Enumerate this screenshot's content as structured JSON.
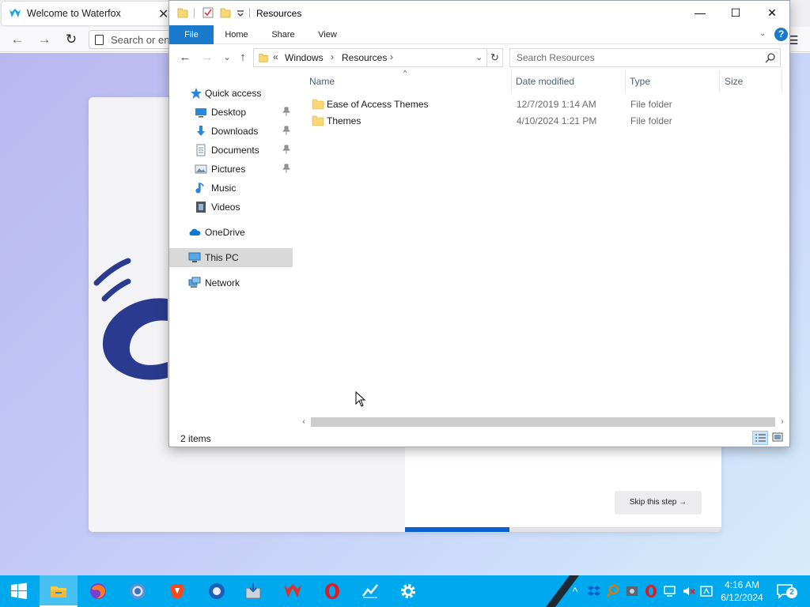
{
  "browser": {
    "tab_title": "Welcome to Waterfox",
    "close_glyph": "✕",
    "url_placeholder": "Search or enter address",
    "back_glyph": "←",
    "forward_glyph": "→",
    "reload_glyph": "↻",
    "menu_glyph": "☰",
    "skip_label": "Skip this step →",
    "progress_fraction": 0.33
  },
  "explorer": {
    "title": "Resources",
    "ribbon_tabs": [
      "File",
      "Home",
      "Share",
      "View"
    ],
    "help_glyph": "?",
    "window_controls": {
      "minimize": "—",
      "maximize": "☐",
      "close": "✕"
    },
    "nav": {
      "back": "←",
      "forward": "→",
      "recent": "⌄",
      "up": "↑",
      "refresh": "↻"
    },
    "breadcrumb": {
      "overflow": "«",
      "items": [
        "Windows",
        "Resources"
      ],
      "sep": "›",
      "dropdown": "⌄"
    },
    "search_placeholder": "Search Resources",
    "sidebar": [
      {
        "label": "Quick access",
        "icon": "star-icon"
      },
      {
        "label": "Desktop",
        "icon": "desktop-icon",
        "pinned": true
      },
      {
        "label": "Downloads",
        "icon": "downloads-icon",
        "pinned": true
      },
      {
        "label": "Documents",
        "icon": "documents-icon",
        "pinned": true
      },
      {
        "label": "Pictures",
        "icon": "pictures-icon",
        "pinned": true
      },
      {
        "label": "Music",
        "icon": "music-icon"
      },
      {
        "label": "Videos",
        "icon": "videos-icon"
      },
      {
        "label": "OneDrive",
        "icon": "cloud-icon"
      },
      {
        "label": "This PC",
        "icon": "computer-icon",
        "selected": true
      },
      {
        "label": "Network",
        "icon": "network-icon"
      }
    ],
    "columns": [
      "Name",
      "Date modified",
      "Type",
      "Size"
    ],
    "sort_glyph": "^",
    "files": [
      {
        "name": "Ease of Access Themes",
        "date": "12/7/2019 1:14 AM",
        "type": "File folder"
      },
      {
        "name": "Themes",
        "date": "4/10/2024 1:21 PM",
        "type": "File folder"
      }
    ],
    "scroll": {
      "left": "‹",
      "right": "›"
    },
    "status": "2 items"
  },
  "taskbar": {
    "apps": [
      "start-icon",
      "file-explorer-icon",
      "firefox-icon",
      "chrome-icon",
      "brave-icon",
      "browser-icon",
      "installer-icon",
      "waterfox-icon",
      "opera-icon",
      "pinned-app-icon",
      "settings-icon"
    ],
    "tray_chevron": "^",
    "time": "4:16 AM",
    "date": "6/12/2024",
    "notification_count": "2",
    "colors": {
      "taskbar": "#00a8ee",
      "accent": "#1979ca"
    }
  }
}
